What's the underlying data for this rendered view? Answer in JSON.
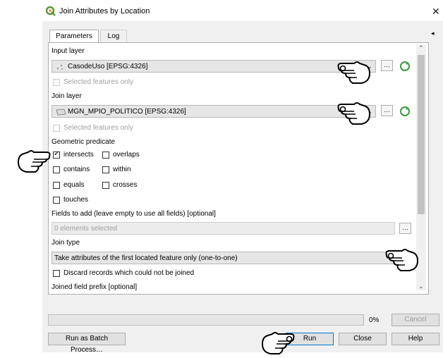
{
  "window": {
    "title": "Join Attributes by Location",
    "close_glyph": "✕"
  },
  "tabs": [
    {
      "label": "Parameters"
    },
    {
      "label": "Log"
    }
  ],
  "collapse_glyph": "◂",
  "form": {
    "input_layer_label": "Input layer",
    "input_layer_value": "CasodeUso [EPSG:4326]",
    "input_selected_only": "Selected features only",
    "join_layer_label": "Join layer",
    "join_layer_value": "MGN_MPIO_POLITICO [EPSG:4326]",
    "join_selected_only": "Selected features only",
    "predicate_label": "Geometric predicate",
    "predicates": [
      {
        "label": "intersects",
        "checked": true
      },
      {
        "label": "overlaps",
        "checked": false
      },
      {
        "label": "contains",
        "checked": false
      },
      {
        "label": "within",
        "checked": false
      },
      {
        "label": "equals",
        "checked": false
      },
      {
        "label": "crosses",
        "checked": false
      },
      {
        "label": "touches",
        "checked": false
      }
    ],
    "fields_label": "Fields to add (leave empty to use all fields) [optional]",
    "fields_value": "0 elements selected",
    "join_type_label": "Join type",
    "join_type_value": "Take attributes of the first located feature only (one-to-one)",
    "discard_label": "Discard records which could not be joined",
    "prefix_label": "Joined field prefix [optional]",
    "ellipsis": "…",
    "check_glyph": "✓"
  },
  "progress": {
    "percent_text": "0%",
    "value": 0
  },
  "buttons": {
    "cancel": "Cancel",
    "batch": "Run as Batch Process…",
    "run": "Run",
    "close": "Close",
    "help": "Help"
  },
  "colors": {
    "qgis_green": "#589632",
    "refresh_green": "#3a9a3a"
  }
}
